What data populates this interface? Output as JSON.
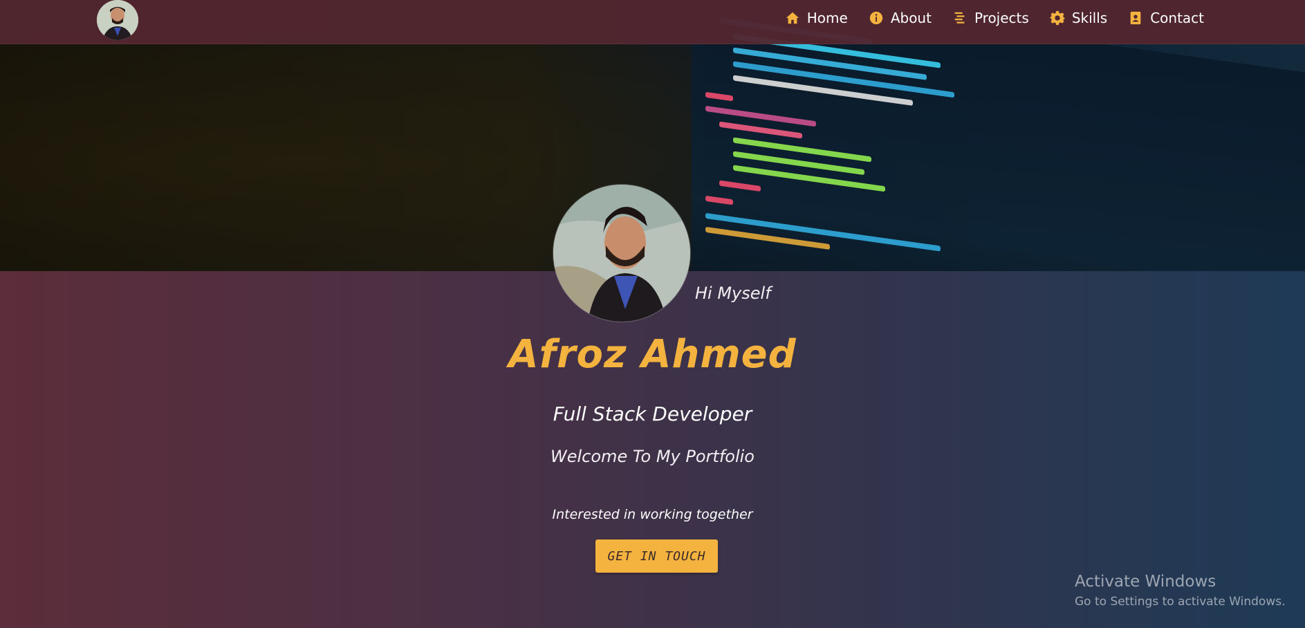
{
  "navbar": {
    "avatar_icon": "profile-photo",
    "links": [
      {
        "label": "Home",
        "icon": "home-icon"
      },
      {
        "label": "About",
        "icon": "info-icon"
      },
      {
        "label": "Projects",
        "icon": "list-icon"
      },
      {
        "label": "Skills",
        "icon": "gear-icon"
      },
      {
        "label": "Contact",
        "icon": "contact-book-icon"
      }
    ]
  },
  "hero": {
    "greeting": "Hi Myself",
    "name": "Afroz Ahmed",
    "role": "Full Stack Developer",
    "welcome": "Welcome To My Portfolio",
    "prompt": "Interested in working together",
    "cta_label": "GET IN TOUCH"
  },
  "watermark": {
    "title": "Activate Windows",
    "subtitle": "Go to Settings to activate Windows."
  },
  "colors": {
    "accent": "#f4b33e",
    "navbar": "#522630",
    "bg_left": "#5c2d3a",
    "bg_right": "#1e3a56"
  }
}
